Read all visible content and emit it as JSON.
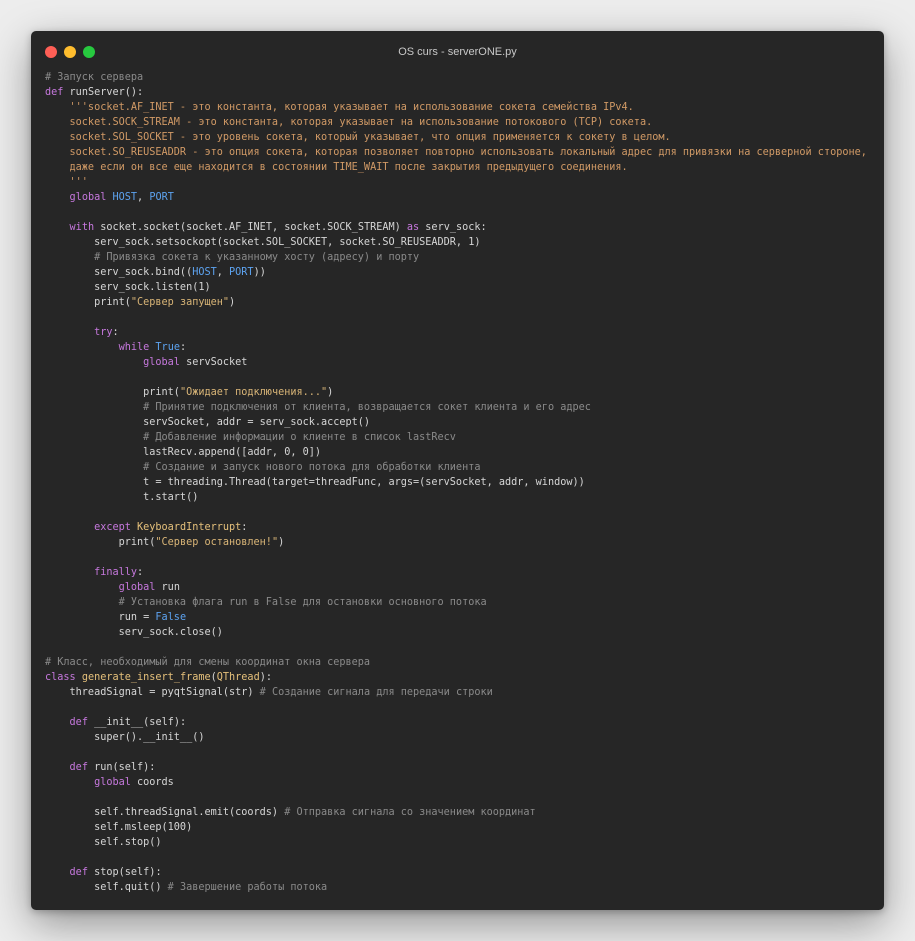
{
  "window": {
    "title": "OS curs - serverONE.py",
    "buttons": {
      "close": "close",
      "minimize": "minimize",
      "maximize": "maximize"
    }
  },
  "colors": {
    "background": "#262626",
    "comment": "#8a8a8a",
    "keyword": "#c678dd",
    "blue": "#5da3f0",
    "docstring": "#d19a66",
    "string": "#d9b577",
    "text": "#d6d6d6",
    "close": "#ff5f56",
    "minimize": "#ffbd2e",
    "maximize": "#27c93f"
  },
  "code": {
    "lines": [
      [
        [
          "c",
          "# Запуск сервера"
        ]
      ],
      [
        [
          "k",
          "def "
        ],
        [
          "f",
          "runServer"
        ],
        [
          "n",
          "():"
        ]
      ],
      [
        [
          "d",
          "    '''socket.AF_INET - это константа, которая указывает на использование сокета семейства IPv4."
        ]
      ],
      [
        [
          "d",
          "    socket.SOCK_STREAM - это константа, которая указывает на использование потокового (TCP) сокета."
        ]
      ],
      [
        [
          "d",
          "    socket.SOL_SOCKET - это уровень сокета, который указывает, что опция применяется к сокету в целом."
        ]
      ],
      [
        [
          "d",
          "    socket.SO_REUSEADDR - это опция сокета, которая позволяет повторно использовать локальный адрес для привязки на серверной стороне,"
        ]
      ],
      [
        [
          "d",
          "    даже если он все еще находится в состоянии TIME_WAIT после закрытия предыдущего соединения."
        ]
      ],
      [
        [
          "d",
          "    '''"
        ]
      ],
      [
        [
          "n",
          "    "
        ],
        [
          "k",
          "global "
        ],
        [
          "kb",
          "HOST"
        ],
        [
          "n",
          ", "
        ],
        [
          "kb",
          "PORT"
        ]
      ],
      [
        [
          "n",
          ""
        ]
      ],
      [
        [
          "n",
          "    "
        ],
        [
          "k",
          "with "
        ],
        [
          "n",
          "socket.socket(socket.AF_INET, socket.SOCK_STREAM) "
        ],
        [
          "k",
          "as "
        ],
        [
          "n",
          "serv_sock:"
        ]
      ],
      [
        [
          "n",
          "        serv_sock.setsockopt(socket.SOL_SOCKET, socket.SO_REUSEADDR, 1)"
        ]
      ],
      [
        [
          "c",
          "        # Привязка сокета к указанному хосту (адресу) и порту"
        ]
      ],
      [
        [
          "n",
          "        serv_sock.bind(("
        ],
        [
          "kb",
          "HOST"
        ],
        [
          "n",
          ", "
        ],
        [
          "kb",
          "PORT"
        ],
        [
          "n",
          "))"
        ]
      ],
      [
        [
          "n",
          "        serv_sock.listen(1)"
        ]
      ],
      [
        [
          "n",
          "        print("
        ],
        [
          "s",
          "\"Сервер запущен\""
        ],
        [
          "n",
          ")"
        ]
      ],
      [
        [
          "n",
          ""
        ]
      ],
      [
        [
          "n",
          "        "
        ],
        [
          "k",
          "try"
        ],
        [
          "n",
          ":"
        ]
      ],
      [
        [
          "n",
          "            "
        ],
        [
          "k",
          "while "
        ],
        [
          "kb",
          "True"
        ],
        [
          "n",
          ":"
        ]
      ],
      [
        [
          "n",
          "                "
        ],
        [
          "k",
          "global "
        ],
        [
          "n",
          "servSocket"
        ]
      ],
      [
        [
          "n",
          ""
        ]
      ],
      [
        [
          "n",
          "                print("
        ],
        [
          "s",
          "\"Ожидает подключения...\""
        ],
        [
          "n",
          ")"
        ]
      ],
      [
        [
          "c",
          "                # Принятие подключения от клиента, возвращается сокет клиента и его адрес"
        ]
      ],
      [
        [
          "n",
          "                servSocket, addr = serv_sock.accept()"
        ]
      ],
      [
        [
          "c",
          "                # Добавление информации о клиенте в список lastRecv"
        ]
      ],
      [
        [
          "n",
          "                lastRecv.append([addr, 0, 0])"
        ]
      ],
      [
        [
          "c",
          "                # Создание и запуск нового потока для обработки клиента"
        ]
      ],
      [
        [
          "n",
          "                t = threading.Thread(target=threadFunc, args=(servSocket, addr, window))"
        ]
      ],
      [
        [
          "n",
          "                t.start()"
        ]
      ],
      [
        [
          "n",
          ""
        ]
      ],
      [
        [
          "n",
          "        "
        ],
        [
          "k",
          "except "
        ],
        [
          "cl",
          "KeyboardInterrupt"
        ],
        [
          "n",
          ":"
        ]
      ],
      [
        [
          "n",
          "            print("
        ],
        [
          "s",
          "\"Сервер остановлен!\""
        ],
        [
          "n",
          ")"
        ]
      ],
      [
        [
          "n",
          ""
        ]
      ],
      [
        [
          "n",
          "        "
        ],
        [
          "k",
          "finally"
        ],
        [
          "n",
          ":"
        ]
      ],
      [
        [
          "n",
          "            "
        ],
        [
          "k",
          "global "
        ],
        [
          "n",
          "run"
        ]
      ],
      [
        [
          "c",
          "            # Установка флага run в False для остановки основного потока"
        ]
      ],
      [
        [
          "n",
          "            run = "
        ],
        [
          "kb",
          "False"
        ]
      ],
      [
        [
          "n",
          "            serv_sock.close()"
        ]
      ],
      [
        [
          "n",
          ""
        ]
      ],
      [
        [
          "c",
          "# Класс, необходимый для смены координат окна сервера"
        ]
      ],
      [
        [
          "k",
          "class "
        ],
        [
          "cl",
          "generate_insert_frame"
        ],
        [
          "n",
          "("
        ],
        [
          "cl",
          "QThread"
        ],
        [
          "n",
          "):"
        ]
      ],
      [
        [
          "n",
          "    threadSignal = pyqtSignal(str) "
        ],
        [
          "c",
          "# Создание сигнала для передачи строки"
        ]
      ],
      [
        [
          "n",
          ""
        ]
      ],
      [
        [
          "n",
          "    "
        ],
        [
          "k",
          "def "
        ],
        [
          "f",
          "__init__"
        ],
        [
          "n",
          "(self):"
        ]
      ],
      [
        [
          "n",
          "        super().__init__()"
        ]
      ],
      [
        [
          "n",
          ""
        ]
      ],
      [
        [
          "n",
          "    "
        ],
        [
          "k",
          "def "
        ],
        [
          "f",
          "run"
        ],
        [
          "n",
          "(self):"
        ]
      ],
      [
        [
          "n",
          "        "
        ],
        [
          "k",
          "global "
        ],
        [
          "n",
          "coords"
        ]
      ],
      [
        [
          "n",
          ""
        ]
      ],
      [
        [
          "n",
          "        self.threadSignal.emit(coords) "
        ],
        [
          "c",
          "# Отправка сигнала со значением координат"
        ]
      ],
      [
        [
          "n",
          "        self.msleep(100)"
        ]
      ],
      [
        [
          "n",
          "        self.stop()"
        ]
      ],
      [
        [
          "n",
          ""
        ]
      ],
      [
        [
          "n",
          "    "
        ],
        [
          "k",
          "def "
        ],
        [
          "f",
          "stop"
        ],
        [
          "n",
          "(self):"
        ]
      ],
      [
        [
          "n",
          "        self.quit() "
        ],
        [
          "c",
          "# Завершение работы потока"
        ]
      ]
    ]
  }
}
